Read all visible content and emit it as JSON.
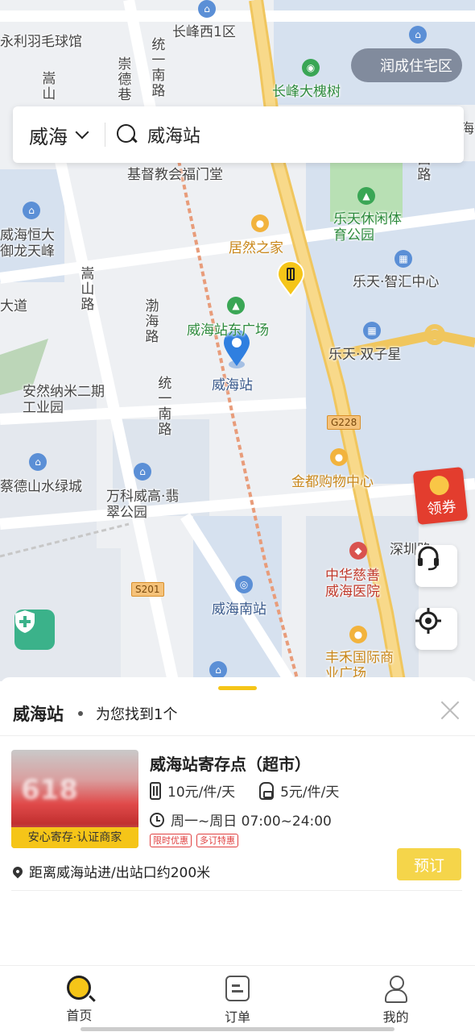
{
  "status_bar": {
    "left": "",
    "right": ""
  },
  "map": {
    "labels": {
      "l1": "永利羽毛球馆",
      "l2": "长峰西1区",
      "l3": "润成住宅区",
      "l4": "长峰大槐树",
      "l5": "嵩山",
      "l6": "崇德巷",
      "l7": "统一南路",
      "l8": "基督教会福门堂",
      "l9": "乐天休闲体育公园",
      "l10": "居然之家",
      "l11": "威海恒大御龙天峰",
      "l12": "嵩山路",
      "l13": "渤海路",
      "l14": "乐天·智汇中心",
      "l15": "大道",
      "l16": "威海站东广场",
      "l17": "乐天·双子星",
      "l18": "威海站",
      "l19": "安然纳米二期工业园",
      "l20": "统一南路",
      "l21": "金都购物中心",
      "l22": "蔡德山水绿城",
      "l23": "万科威高·翡翠公园",
      "l24": "深圳路",
      "l25": "中华慈善威海医院",
      "l26": "威海南站",
      "l27": "丰禾国际商业广场",
      "l28": "西路",
      "l29": "海"
    },
    "road_badges": {
      "g228": "G228",
      "s201": "S201"
    }
  },
  "location_pill": {
    "label": "润成住宅区"
  },
  "search": {
    "city": "威海",
    "query": "威海站"
  },
  "coupon": {
    "label": "领券"
  },
  "sheet": {
    "title": "威海站",
    "result_count": "为您找到1个",
    "card": {
      "name": "威海站寄存点（超市）",
      "thumb_text": "618",
      "thumb_badge": "安心寄存·认证商家",
      "price_large": "10元/件/天",
      "price_small": "5元/件/天",
      "hours": "周一~周日 07:00~24:00",
      "tags": [
        "限时优惠",
        "多订特惠"
      ],
      "book_label": "预订",
      "distance": "距离威海站进/出站口约200米"
    }
  },
  "nav": {
    "home": "首页",
    "orders": "订单",
    "mine": "我的"
  },
  "colors": {
    "accent": "#f5c518",
    "map_bg": "#eef0f3",
    "road_main": "#f6cd6b",
    "water": "#b9cde8",
    "park": "#a9d9a6"
  }
}
